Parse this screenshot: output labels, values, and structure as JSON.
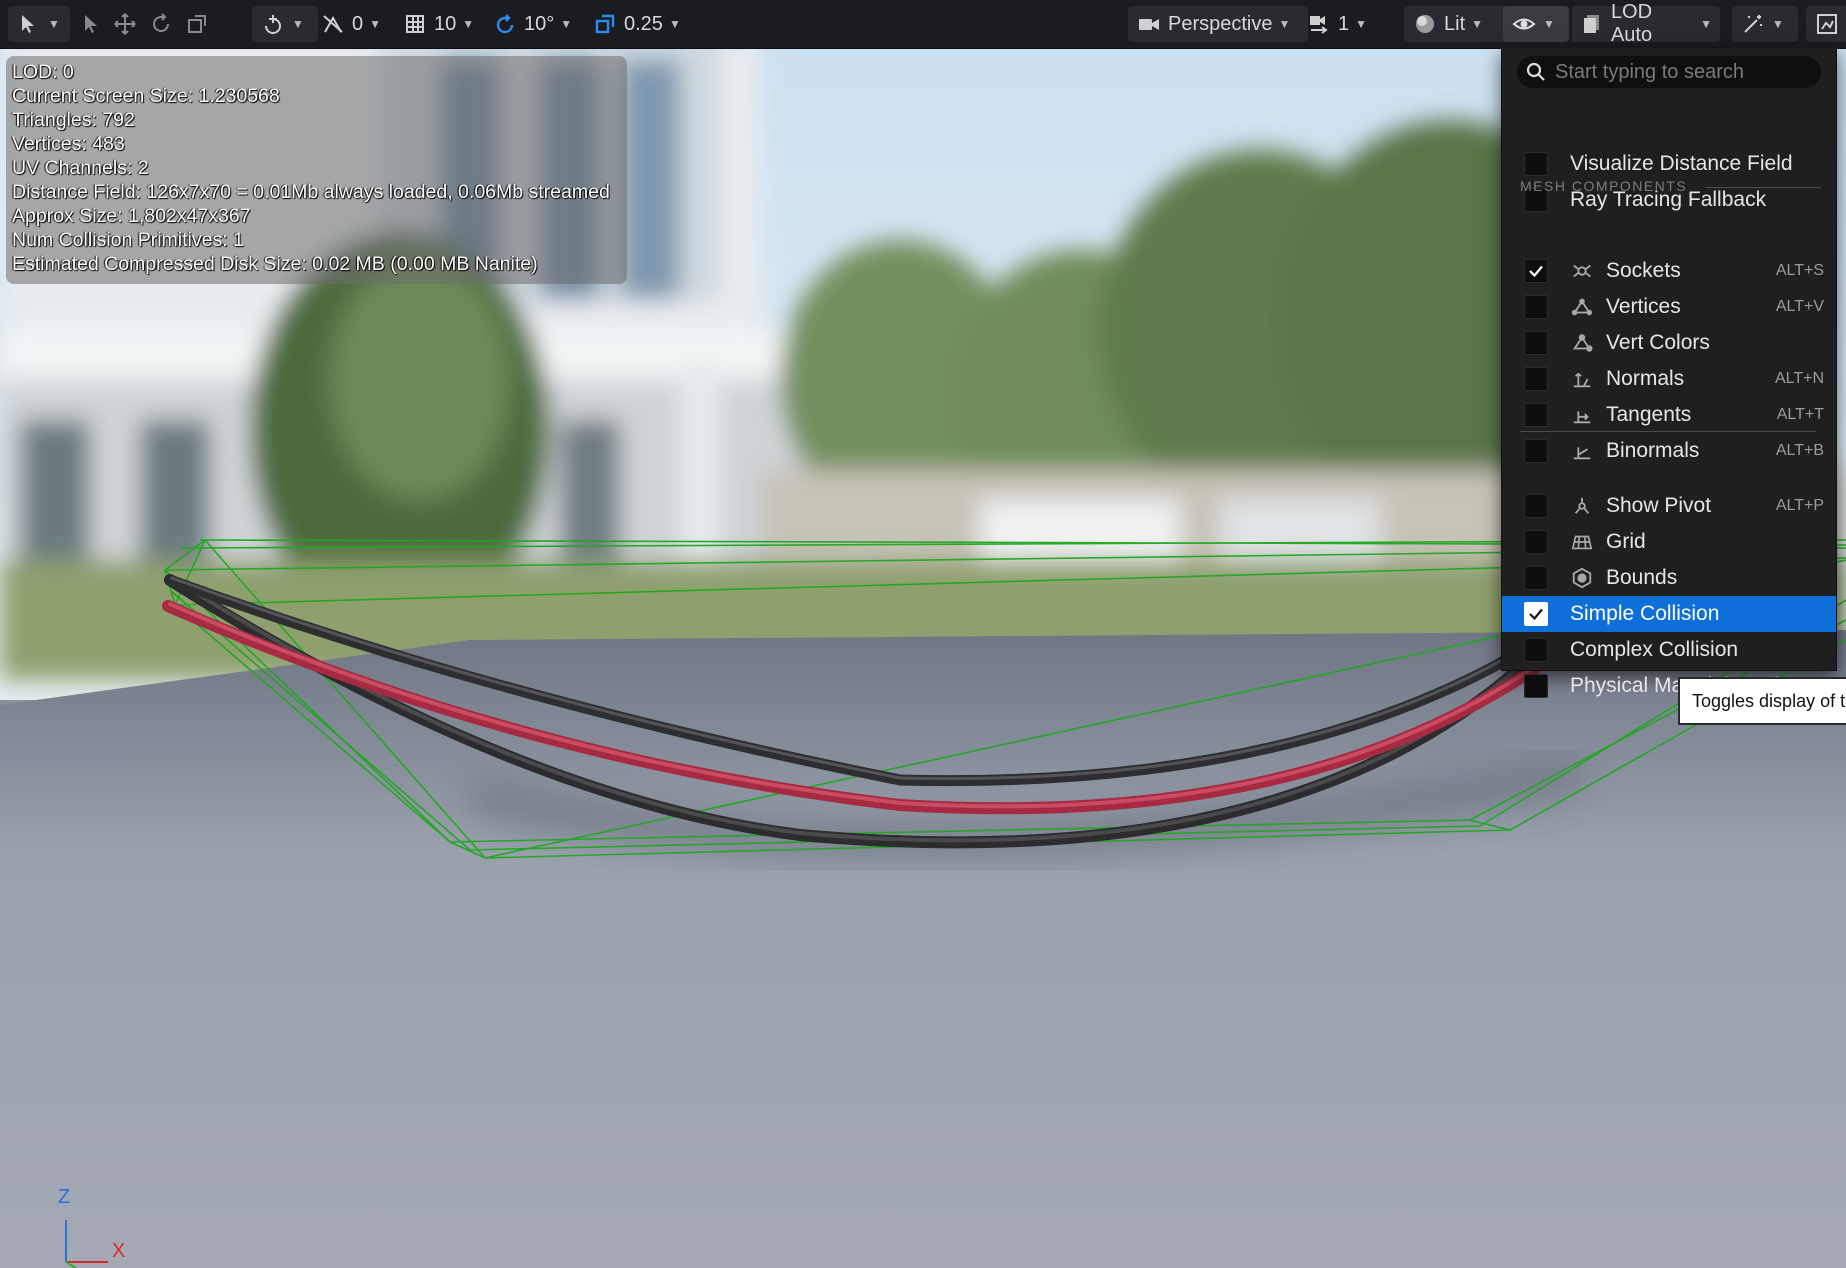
{
  "toolbar": {
    "select_mode_icon": "select-mode-icon",
    "tools": [
      "select-arrow-icon",
      "translate-icon",
      "rotate-icon",
      "scale-icon"
    ],
    "surface_snap_icon": "surface-snap-icon",
    "snap_value": "0",
    "grid_snap": "10",
    "rotation_snap": "10°",
    "scale_snap": "0.25",
    "view_mode": "Perspective",
    "camera_speed": "1",
    "lit_mode": "Lit",
    "show_icon": "eye-icon",
    "lod_mode": "LOD Auto",
    "colors": {
      "accent": "#2b8bf0",
      "background": "#1b1c20"
    }
  },
  "stats": {
    "lines": [
      "LOD:  0",
      "Current Screen Size:  1.230568",
      "Triangles:  792",
      "Vertices:  483",
      "UV Channels:  2",
      "Distance Field:  126x7x70 = 0.01Mb always loaded, 0.06Mb streamed",
      "Approx Size: 1,802x47x367",
      "Num Collision Primitives:  1",
      "Estimated Compressed Disk Size: 0.02 MB (0.00 MB Nanite)"
    ]
  },
  "menu": {
    "search_placeholder": "Start typing to search",
    "section_label": "MESH COMPONENTS",
    "items": [
      {
        "label": "Visualize Distance Field",
        "checked": false,
        "icon": "",
        "shortcut": ""
      },
      {
        "label": "Ray Tracing Fallback",
        "checked": false,
        "icon": "",
        "shortcut": ""
      },
      {
        "label": "Sockets",
        "checked": true,
        "icon": "socket-icon",
        "shortcut": "ALT+S"
      },
      {
        "label": "Vertices",
        "checked": false,
        "icon": "vertices-icon",
        "shortcut": "ALT+V"
      },
      {
        "label": "Vert Colors",
        "checked": false,
        "icon": "vert-colors-icon",
        "shortcut": ""
      },
      {
        "label": "Normals",
        "checked": false,
        "icon": "normals-icon",
        "shortcut": "ALT+N"
      },
      {
        "label": "Tangents",
        "checked": false,
        "icon": "tangents-icon",
        "shortcut": "ALT+T"
      },
      {
        "label": "Binormals",
        "checked": false,
        "icon": "binormals-icon",
        "shortcut": "ALT+B"
      },
      {
        "label": "Show Pivot",
        "checked": false,
        "icon": "pivot-icon",
        "shortcut": "ALT+P"
      },
      {
        "label": "Grid",
        "checked": false,
        "icon": "grid-icon",
        "shortcut": ""
      },
      {
        "label": "Bounds",
        "checked": false,
        "icon": "bounds-icon",
        "shortcut": ""
      },
      {
        "label": "Simple Collision",
        "checked": true,
        "icon": "",
        "shortcut": "",
        "selected": true
      },
      {
        "label": "Complex Collision",
        "checked": false,
        "icon": "",
        "shortcut": ""
      },
      {
        "label": "Physical Material Masks",
        "checked": false,
        "icon": "",
        "shortcut": ""
      }
    ],
    "selected_color": "#0f6fd8"
  },
  "tooltip": {
    "text": "Toggles display of t"
  },
  "gizmo": {
    "z_label": "Z",
    "x_label": "X"
  }
}
